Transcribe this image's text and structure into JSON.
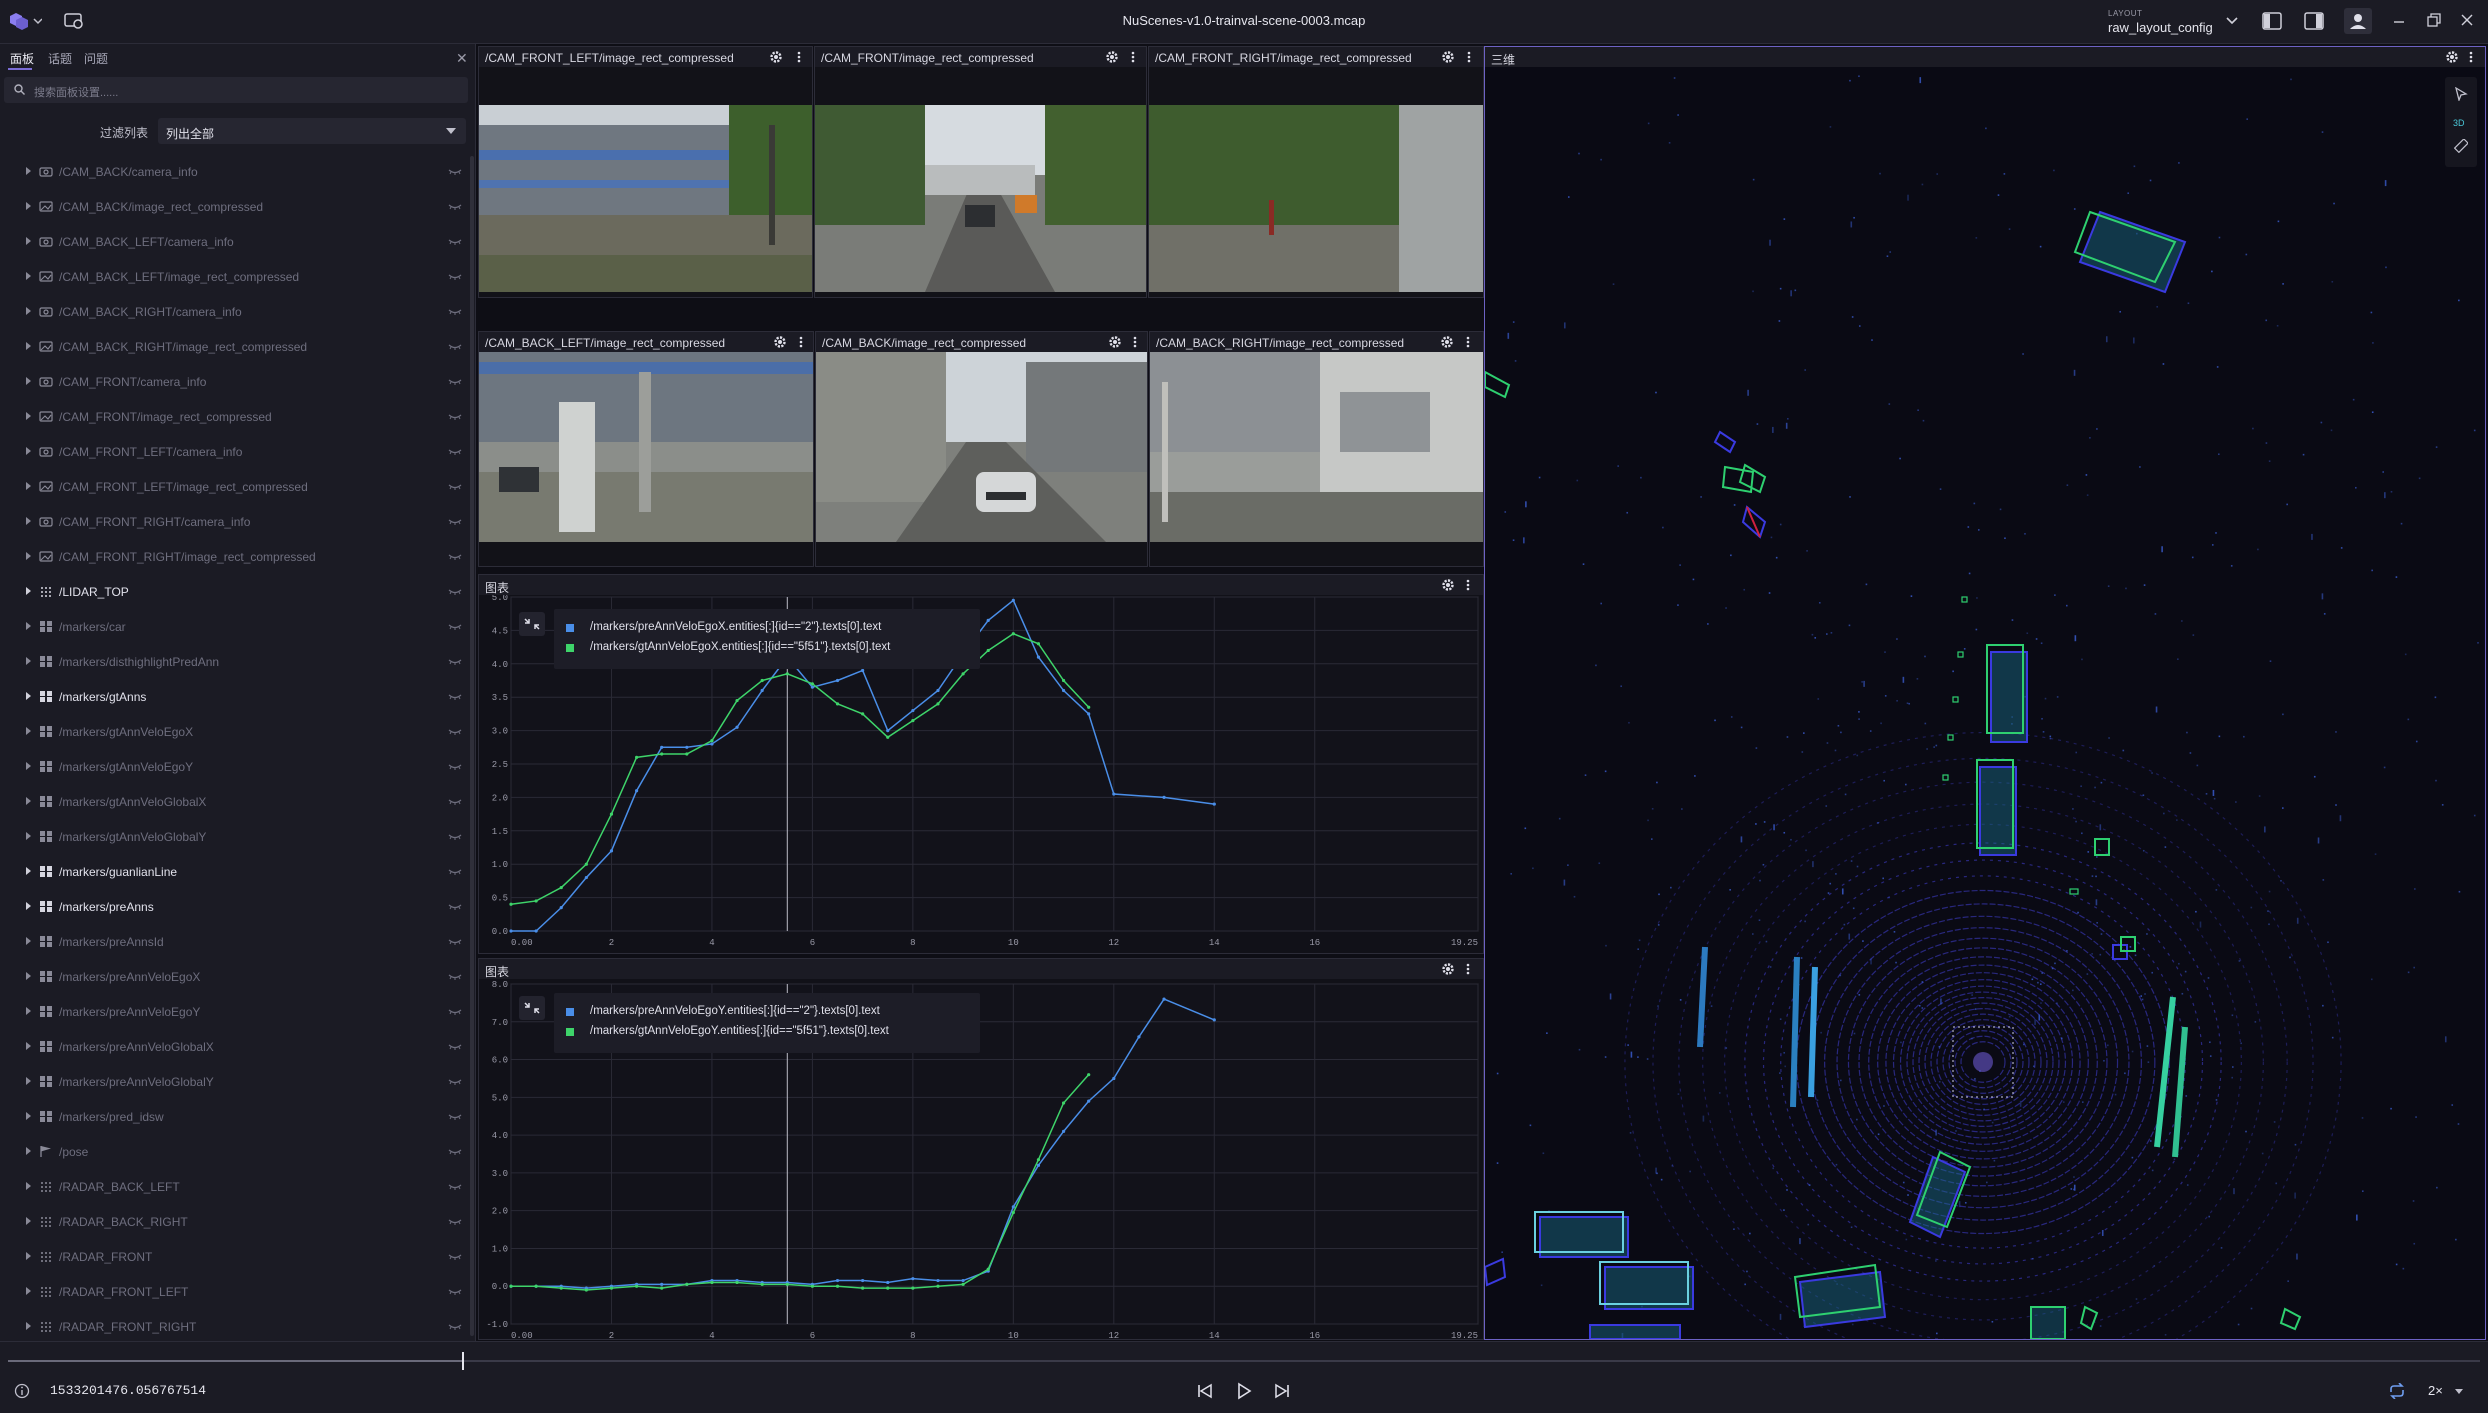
{
  "app": {
    "title": "NuScenes-v1.0-trainval-scene-0003.mcap"
  },
  "topbar": {
    "layout_label": "LAYOUT",
    "layout_name": "raw_layout_config"
  },
  "sidebar": {
    "tabs": [
      "面板",
      "话题",
      "问题"
    ],
    "search_placeholder": "搜索面板设置......",
    "filter_label": "过滤列表",
    "filter_value": "列出全部",
    "topics": [
      {
        "label": "/CAM_BACK/camera_info",
        "icon": "camera-icon",
        "active": false,
        "expandable": true
      },
      {
        "label": "/CAM_BACK/image_rect_compressed",
        "icon": "image-icon",
        "active": false,
        "expandable": true
      },
      {
        "label": "/CAM_BACK_LEFT/camera_info",
        "icon": "camera-icon",
        "active": false,
        "expandable": true
      },
      {
        "label": "/CAM_BACK_LEFT/image_rect_compressed",
        "icon": "image-icon",
        "active": false,
        "expandable": true
      },
      {
        "label": "/CAM_BACK_RIGHT/camera_info",
        "icon": "camera-icon",
        "active": false,
        "expandable": true
      },
      {
        "label": "/CAM_BACK_RIGHT/image_rect_compressed",
        "icon": "image-icon",
        "active": false,
        "expandable": true
      },
      {
        "label": "/CAM_FRONT/camera_info",
        "icon": "camera-icon",
        "active": false,
        "expandable": true
      },
      {
        "label": "/CAM_FRONT/image_rect_compressed",
        "icon": "image-icon",
        "active": false,
        "expandable": true
      },
      {
        "label": "/CAM_FRONT_LEFT/camera_info",
        "icon": "camera-icon",
        "active": false,
        "expandable": true
      },
      {
        "label": "/CAM_FRONT_LEFT/image_rect_compressed",
        "icon": "image-icon",
        "active": false,
        "expandable": true
      },
      {
        "label": "/CAM_FRONT_RIGHT/camera_info",
        "icon": "camera-icon",
        "active": false,
        "expandable": true
      },
      {
        "label": "/CAM_FRONT_RIGHT/image_rect_compressed",
        "icon": "image-icon",
        "active": false,
        "expandable": true
      },
      {
        "label": "/LIDAR_TOP",
        "icon": "pointcloud-icon",
        "active": true,
        "expandable": true
      },
      {
        "label": "/markers/car",
        "icon": "markers-icon",
        "active": false,
        "expandable": true
      },
      {
        "label": "/markers/disthighlightPredAnn",
        "icon": "markers-icon",
        "active": false,
        "expandable": true
      },
      {
        "label": "/markers/gtAnns",
        "icon": "markers-icon",
        "active": true,
        "expandable": true
      },
      {
        "label": "/markers/gtAnnVeloEgoX",
        "icon": "markers-icon",
        "active": false,
        "expandable": true
      },
      {
        "label": "/markers/gtAnnVeloEgoY",
        "icon": "markers-icon",
        "active": false,
        "expandable": true
      },
      {
        "label": "/markers/gtAnnVeloGlobalX",
        "icon": "markers-icon",
        "active": false,
        "expandable": true
      },
      {
        "label": "/markers/gtAnnVeloGlobalY",
        "icon": "markers-icon",
        "active": false,
        "expandable": true
      },
      {
        "label": "/markers/guanlianLine",
        "icon": "markers-icon",
        "active": true,
        "expandable": true
      },
      {
        "label": "/markers/preAnns",
        "icon": "markers-icon",
        "active": true,
        "expandable": true
      },
      {
        "label": "/markers/preAnnsId",
        "icon": "markers-icon",
        "active": false,
        "expandable": true
      },
      {
        "label": "/markers/preAnnVeloEgoX",
        "icon": "markers-icon",
        "active": false,
        "expandable": true
      },
      {
        "label": "/markers/preAnnVeloEgoY",
        "icon": "markers-icon",
        "active": false,
        "expandable": true
      },
      {
        "label": "/markers/preAnnVeloGlobalX",
        "icon": "markers-icon",
        "active": false,
        "expandable": true
      },
      {
        "label": "/markers/preAnnVeloGlobalY",
        "icon": "markers-icon",
        "active": false,
        "expandable": true
      },
      {
        "label": "/markers/pred_idsw",
        "icon": "markers-icon",
        "active": false,
        "expandable": true
      },
      {
        "label": "/pose",
        "icon": "flag-icon",
        "active": false,
        "expandable": true
      },
      {
        "label": "/RADAR_BACK_LEFT",
        "icon": "pointcloud-icon",
        "active": false,
        "expandable": true
      },
      {
        "label": "/RADAR_BACK_RIGHT",
        "icon": "pointcloud-icon",
        "active": false,
        "expandable": true
      },
      {
        "label": "/RADAR_FRONT",
        "icon": "pointcloud-icon",
        "active": false,
        "expandable": true
      },
      {
        "label": "/RADAR_FRONT_LEFT",
        "icon": "pointcloud-icon",
        "active": false,
        "expandable": true
      },
      {
        "label": "/RADAR_FRONT_RIGHT",
        "icon": "pointcloud-icon",
        "active": false,
        "expandable": true
      }
    ]
  },
  "cameras": [
    {
      "title": "/CAM_FRONT_LEFT/image_rect_compressed"
    },
    {
      "title": "/CAM_FRONT/image_rect_compressed"
    },
    {
      "title": "/CAM_FRONT_RIGHT/image_rect_compressed"
    },
    {
      "title": "/CAM_BACK_LEFT/image_rect_compressed"
    },
    {
      "title": "/CAM_BACK/image_rect_compressed"
    },
    {
      "title": "/CAM_BACK_RIGHT/image_rect_compressed"
    }
  ],
  "plot1": {
    "title": "图表"
  },
  "plot2": {
    "title": "图表"
  },
  "view3d": {
    "title": "三维",
    "mode_label": "3D"
  },
  "timeline": {
    "time": "1533201476.056767514",
    "speed": "2×",
    "progress": 0.184
  },
  "colors": {
    "series_pred": "#4a8ee8",
    "series_gt": "#3ed46a",
    "accent": "#7b6dd6",
    "grid": "#2a2a36"
  },
  "chart_data": [
    {
      "type": "line",
      "title": "",
      "xlabel": "",
      "ylabel": "",
      "xlim": [
        0,
        19.25
      ],
      "ylim": [
        0,
        5.0
      ],
      "xticks": [
        "0.00",
        "2",
        "4",
        "6",
        "8",
        "10",
        "12",
        "14",
        "16",
        "19.25"
      ],
      "yticks": [
        "0.0",
        "0.5",
        "1.0",
        "1.5",
        "2.0",
        "2.5",
        "3.0",
        "3.5",
        "4.0",
        "4.5",
        "5.0"
      ],
      "cursor_x": 5.5,
      "grid": true,
      "legend": "top-left",
      "series": [
        {
          "name": "/markers/preAnnVeloEgoX.entities[:]{id==\"2\"}.texts[0].text",
          "color": "#4a8ee8",
          "x": [
            0.0,
            0.5,
            1.0,
            1.5,
            2.0,
            2.5,
            3.0,
            3.5,
            4.0,
            4.5,
            5.0,
            5.5,
            6.0,
            6.5,
            7.0,
            7.5,
            8.0,
            8.5,
            9.0,
            9.5,
            10.0,
            10.5,
            11.0,
            11.5,
            12.0,
            13.0,
            14.0
          ],
          "y": [
            0.0,
            0.0,
            0.35,
            0.8,
            1.2,
            2.1,
            2.75,
            2.75,
            2.8,
            3.05,
            3.6,
            4.1,
            3.65,
            3.75,
            3.9,
            3.0,
            3.3,
            3.6,
            4.15,
            4.65,
            4.95,
            4.1,
            3.6,
            3.25,
            2.05,
            2.0,
            1.9
          ]
        },
        {
          "name": "/markers/gtAnnVeloEgoX.entities[:]{id==\"5f51\"}.texts[0].text",
          "color": "#3ed46a",
          "x": [
            0.0,
            0.5,
            1.0,
            1.5,
            2.0,
            2.5,
            3.0,
            3.5,
            4.0,
            4.5,
            5.0,
            5.5,
            6.0,
            6.5,
            7.0,
            7.5,
            8.0,
            8.5,
            9.0,
            9.5,
            10.0,
            10.5,
            11.0,
            11.5
          ],
          "y": [
            0.4,
            0.45,
            0.65,
            1.0,
            1.75,
            2.6,
            2.65,
            2.65,
            2.85,
            3.45,
            3.75,
            3.85,
            3.7,
            3.4,
            3.25,
            2.9,
            3.15,
            3.4,
            3.85,
            4.2,
            4.45,
            4.3,
            3.75,
            3.35
          ]
        }
      ]
    },
    {
      "type": "line",
      "title": "",
      "xlabel": "",
      "ylabel": "",
      "xlim": [
        0,
        19.25
      ],
      "ylim": [
        -1.0,
        8.0
      ],
      "xticks": [
        "0.00",
        "2",
        "4",
        "6",
        "8",
        "10",
        "12",
        "14",
        "16",
        "19.25"
      ],
      "yticks": [
        "-1.0",
        "0.0",
        "1.0",
        "2.0",
        "3.0",
        "4.0",
        "5.0",
        "6.0",
        "7.0",
        "8.0"
      ],
      "cursor_x": 5.5,
      "grid": true,
      "legend": "top-left",
      "series": [
        {
          "name": "/markers/preAnnVeloEgoY.entities[:]{id==\"2\"}.texts[0].text",
          "color": "#4a8ee8",
          "x": [
            0.0,
            0.5,
            1.0,
            1.5,
            2.0,
            2.5,
            3.0,
            3.5,
            4.0,
            4.5,
            5.0,
            5.5,
            6.0,
            6.5,
            7.0,
            7.5,
            8.0,
            8.5,
            9.0,
            9.5,
            10.0,
            10.5,
            11.0,
            11.5,
            12.0,
            12.5,
            13.0,
            14.0
          ],
          "y": [
            0.0,
            0.0,
            0.0,
            -0.05,
            0.0,
            0.05,
            0.05,
            0.05,
            0.15,
            0.15,
            0.1,
            0.1,
            0.05,
            0.15,
            0.15,
            0.1,
            0.2,
            0.15,
            0.15,
            0.4,
            2.1,
            3.2,
            4.1,
            4.9,
            5.5,
            6.6,
            7.6,
            7.05
          ]
        },
        {
          "name": "/markers/gtAnnVeloEgoY.entities[:]{id==\"5f51\"}.texts[0].text",
          "color": "#3ed46a",
          "x": [
            0.0,
            0.5,
            1.0,
            1.5,
            2.0,
            2.5,
            3.0,
            3.5,
            4.0,
            4.5,
            5.0,
            5.5,
            6.0,
            6.5,
            7.0,
            7.5,
            8.0,
            8.5,
            9.0,
            9.5,
            10.0,
            10.5,
            11.0,
            11.5
          ],
          "y": [
            0.0,
            0.0,
            -0.05,
            -0.1,
            -0.05,
            0.0,
            -0.05,
            0.05,
            0.1,
            0.1,
            0.05,
            0.05,
            0.0,
            0.0,
            -0.05,
            -0.05,
            -0.05,
            0.0,
            0.05,
            0.45,
            1.95,
            3.35,
            4.85,
            5.6
          ]
        }
      ]
    }
  ]
}
